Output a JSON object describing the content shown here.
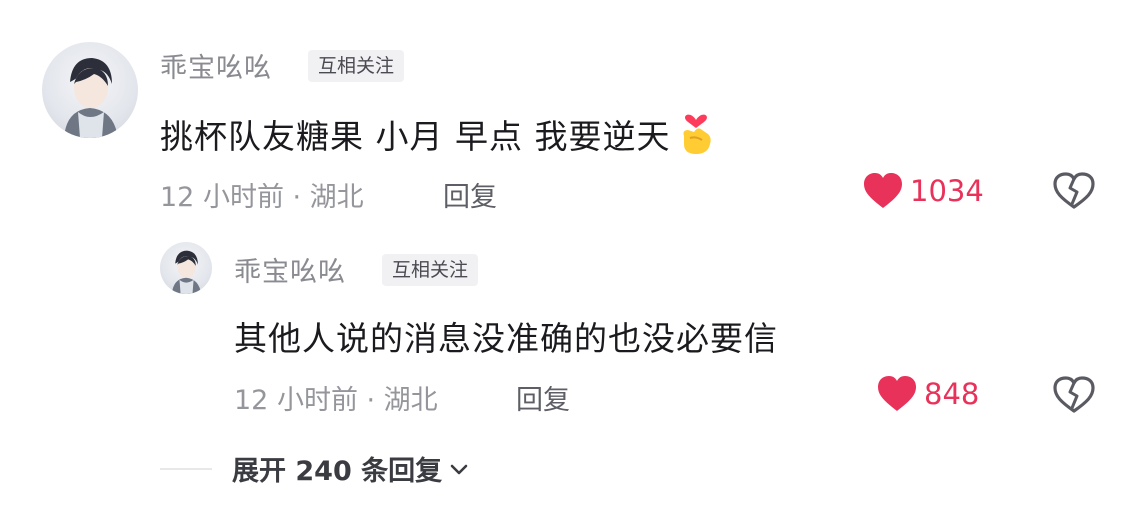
{
  "comments": [
    {
      "name": "乖宝吆吆",
      "tag": "互相关注",
      "text": "挑杯队友糖果 小月 早点 我要逆天",
      "emoji": "finger-heart-emoji",
      "time_location": "12 小时前 · 湖北",
      "reply_label": "回复",
      "likes": "1034"
    },
    {
      "name": "乖宝吆吆",
      "tag": "互相关注",
      "text": "其他人说的消息没准确的也没必要信",
      "time_location": "12 小时前 · 湖北",
      "reply_label": "回复",
      "likes": "848"
    }
  ],
  "expand_replies": "展开 240 条回复",
  "colors": {
    "like": "#e8325a",
    "meta": "#95969c",
    "tag_bg": "#f1f1f3"
  },
  "icons": [
    "heart-icon",
    "broken-heart-icon",
    "chevron-down-icon"
  ]
}
